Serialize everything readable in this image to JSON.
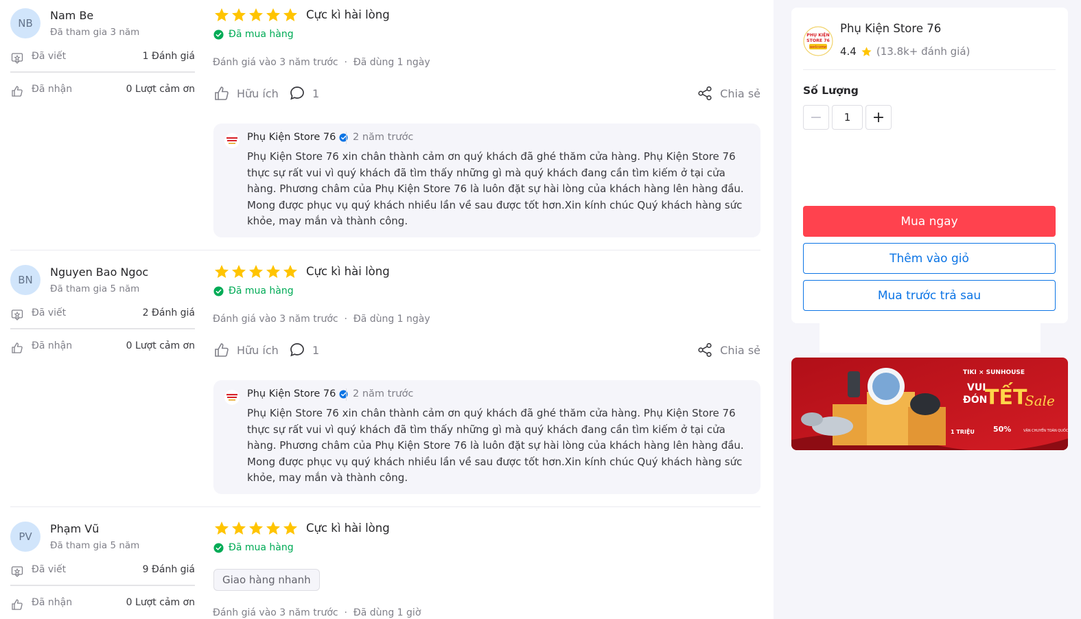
{
  "reviews": [
    {
      "initials": "NB",
      "name": "Nam Be",
      "joined": "Đã tham gia 3 năm",
      "written_label": "Đã viết",
      "written_value": "1 Đánh giá",
      "received_label": "Đã nhận",
      "received_value": "0 Lượt cảm ơn",
      "rating": 5,
      "title": "Cực kì hài lòng",
      "bought": "Đã mua hàng",
      "meta": "Đánh giá vào 3 năm trước  ·  Đã dùng 1 ngày",
      "helpful": "Hữu ích",
      "comments": "1",
      "share": "Chia sẻ",
      "reply": {
        "shop": "Phụ Kiện Store 76",
        "time": "2 năm trước",
        "text": "Phụ Kiện Store 76 xin chân thành cảm ơn quý khách đã ghé thăm cửa hàng. Phụ Kiện Store 76 thực sự rất vui vì quý khách đã tìm thấy những gì mà quý khách đang cần tìm kiếm ở tại cửa hàng. Phương châm của Phụ Kiện Store 76 là luôn đặt sự hài lòng của khách hàng lên hàng đầu. Mong được phục vụ quý khách nhiều lần về sau được tốt hơn.Xin kính chúc Quý khách hàng sức khỏe, may mắn và thành công."
      }
    },
    {
      "initials": "BN",
      "name": "Nguyen Bao Ngoc",
      "joined": "Đã tham gia 5 năm",
      "written_label": "Đã viết",
      "written_value": "2 Đánh giá",
      "received_label": "Đã nhận",
      "received_value": "0 Lượt cảm ơn",
      "rating": 5,
      "title": "Cực kì hài lòng",
      "bought": "Đã mua hàng",
      "meta": "Đánh giá vào 3 năm trước  ·  Đã dùng 1 ngày",
      "helpful": "Hữu ích",
      "comments": "1",
      "share": "Chia sẻ",
      "reply": {
        "shop": "Phụ Kiện Store 76",
        "time": "2 năm trước",
        "text": "Phụ Kiện Store 76 xin chân thành cảm ơn quý khách đã ghé thăm cửa hàng. Phụ Kiện Store 76 thực sự rất vui vì quý khách đã tìm thấy những gì mà quý khách đang cần tìm kiếm ở tại cửa hàng. Phương châm của Phụ Kiện Store 76 là luôn đặt sự hài lòng của khách hàng lên hàng đầu. Mong được phục vụ quý khách nhiều lần về sau được tốt hơn.Xin kính chúc Quý khách hàng sức khỏe, may mắn và thành công."
      }
    },
    {
      "initials": "PV",
      "name": "Phạm Vũ",
      "joined": "Đã tham gia 5 năm",
      "written_label": "Đã viết",
      "written_value": "9 Đánh giá",
      "received_label": "Đã nhận",
      "received_value": "0 Lượt cảm ơn",
      "rating": 5,
      "title": "Cực kì hài lòng",
      "bought": "Đã mua hàng",
      "tag": "Giao hàng nhanh",
      "meta": "Đánh giá vào 3 năm trước  ·  Đã dùng 1 giờ"
    }
  ],
  "seller": {
    "logo_text": [
      "PHỤ KIỆN",
      "STORE 76",
      "welcome"
    ],
    "name": "Phụ Kiện Store 76",
    "rating": "4.4",
    "rating_count": "(13.8k+ đánh giá)"
  },
  "purchase": {
    "qty_label": "Số Lượng",
    "qty_value": "1",
    "minus": "−",
    "plus": "+",
    "buy_now": "Mua ngay",
    "add_to_cart": "Thêm vào giỏ",
    "buy_later": "Mua trước trả sau"
  },
  "banner": {
    "brand": "TIKI × SUNHOUSE",
    "line1": "VUI",
    "line2": "ĐÓN",
    "big": "TẾT",
    "script": "Sale",
    "promo1": "1 TRIỆU",
    "promo2": "50%",
    "promo3": "VẬN CHUYỂN TOÀN QUỐC"
  },
  "colors": {
    "star": "#ffc400",
    "bought": "#00ab56",
    "buy_button": "#ff424e",
    "outline_button": "#0b74e5",
    "avatar_bg": "#d1e5fb",
    "banner_red": "#c8111b"
  }
}
